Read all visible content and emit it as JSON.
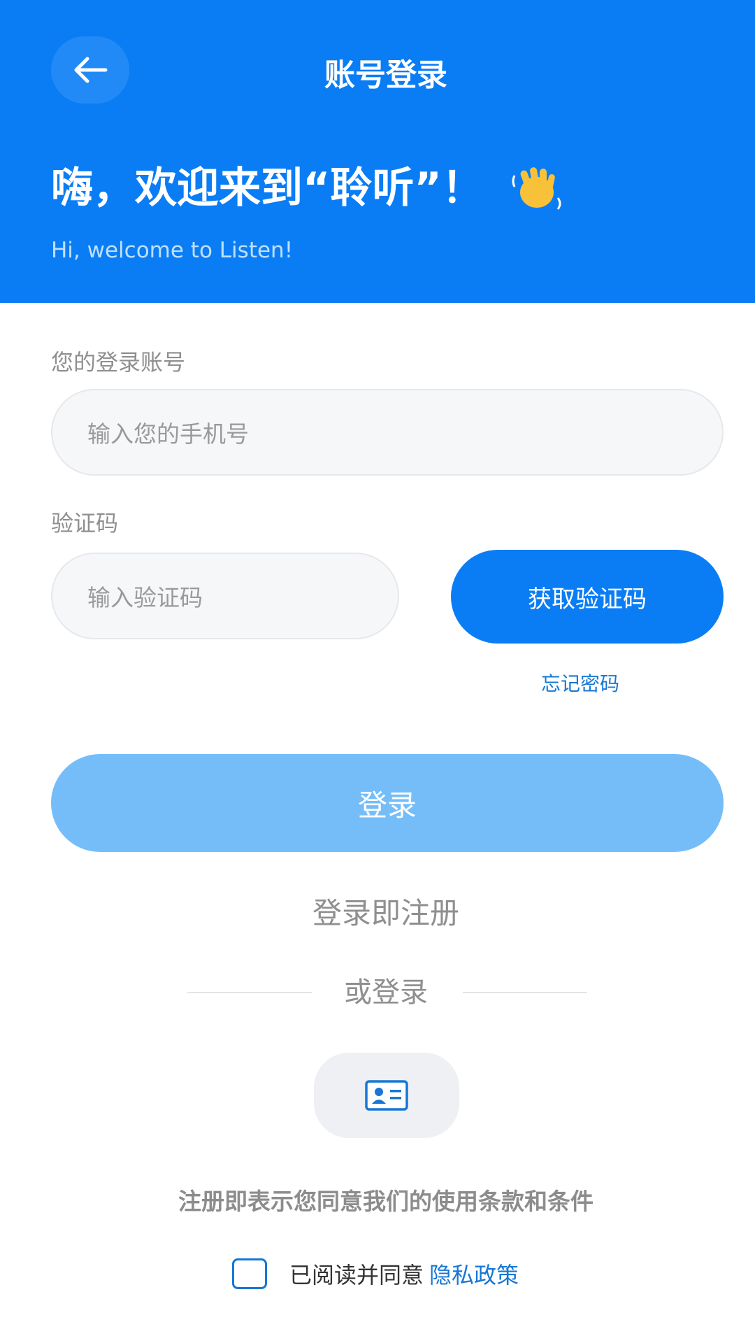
{
  "header": {
    "title": "账号登录",
    "welcome": "嗨，欢迎来到“聆听”！",
    "welcome_en": "Hi, welcome to Listen!"
  },
  "form": {
    "account_label": "您的登录账号",
    "phone_placeholder": "输入您的手机号",
    "code_label": "验证码",
    "code_placeholder": "输入验证码",
    "get_code_label": "获取验证码",
    "forgot_label": "忘记密码",
    "login_label": "登录",
    "register_note": "登录即注册",
    "or_login": "或登录"
  },
  "footer": {
    "terms": "注册即表示您同意我们的使用条款和条件",
    "agree_text": "已阅读并同意",
    "privacy_link": "隐私政策"
  },
  "colors": {
    "primary": "#0a7df5",
    "login_disabled": "#75bdf9",
    "link": "#1777d4"
  },
  "icons": {
    "back": "arrow-left-icon",
    "wave": "waving-hand-icon",
    "alt_login": "id-card-icon"
  }
}
